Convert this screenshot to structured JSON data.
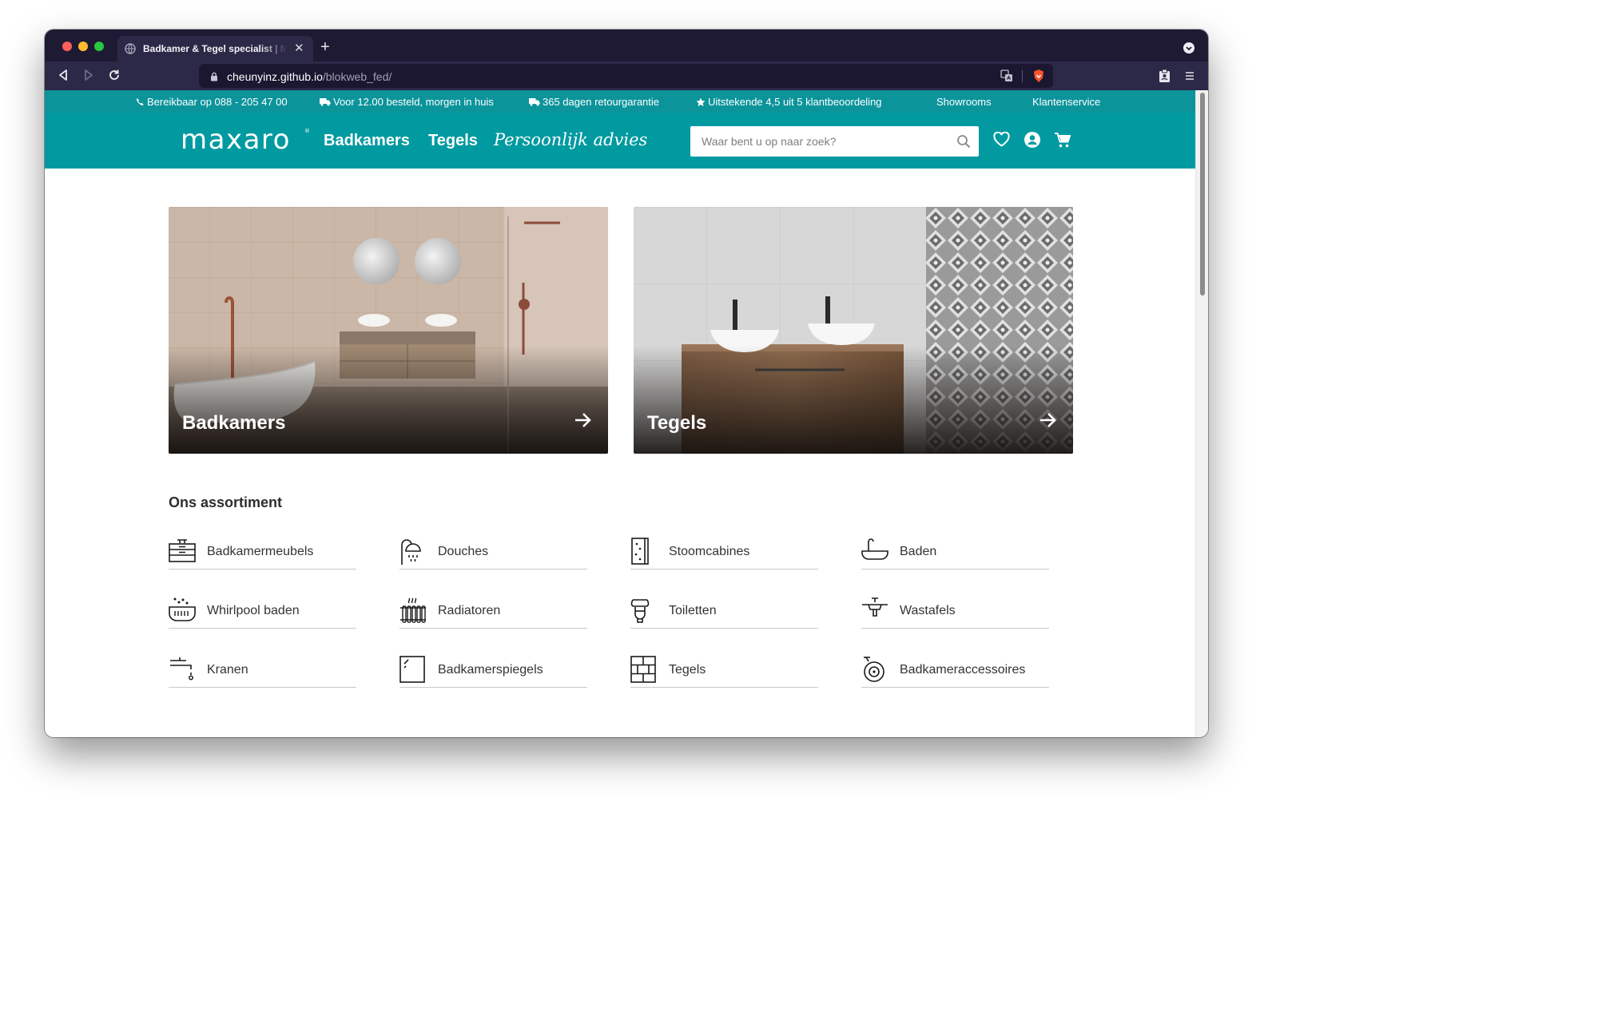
{
  "browser": {
    "tab_title": "Badkamer & Tegel specialist | Maxaro",
    "url_host": "cheunyinz.github.io",
    "url_path": "/blokweb_fed/",
    "colors": {
      "chrome_dark": "#1e1a33",
      "chrome_tab": "#2c2847",
      "close": "#fe5f57",
      "minimize": "#febc2e",
      "zoom": "#28c840"
    }
  },
  "topbar": {
    "items": [
      {
        "icon": "phone-icon",
        "label": "Bereikbaar op 088 - 205 47 00"
      },
      {
        "icon": "truck-icon",
        "label": "Voor 12.00 besteld, morgen in huis"
      },
      {
        "icon": "truck-icon",
        "label": "365 dagen retourgarantie"
      },
      {
        "icon": "star-icon",
        "label": "Uitstekende 4,5 uit 5 klantbeoordeling"
      },
      {
        "label": "Showrooms"
      },
      {
        "label": "Klantenservice"
      }
    ]
  },
  "header": {
    "logo": "maxaro",
    "logo_mark": "®",
    "nav": [
      "Badkamers",
      "Tegels",
      "Persoonlijk advies"
    ],
    "search_placeholder": "Waar bent u op naar zoek?",
    "brand_color": "#009aa0"
  },
  "hero": [
    {
      "label": "Badkamers"
    },
    {
      "label": "Tegels"
    }
  ],
  "assortment": {
    "title": "Ons assortiment",
    "items": [
      {
        "label": "Badkamermeubels",
        "icon": "vanity-cabinet-icon"
      },
      {
        "label": "Douches",
        "icon": "shower-icon"
      },
      {
        "label": "Stoomcabines",
        "icon": "steam-cabin-icon"
      },
      {
        "label": "Baden",
        "icon": "bathtub-icon"
      },
      {
        "label": "Whirlpool baden",
        "icon": "whirlpool-icon"
      },
      {
        "label": "Radiatoren",
        "icon": "radiator-icon"
      },
      {
        "label": "Toiletten",
        "icon": "toilet-icon"
      },
      {
        "label": "Wastafels",
        "icon": "sink-icon"
      },
      {
        "label": "Kranen",
        "icon": "faucet-icon"
      },
      {
        "label": "Badkamerspiegels",
        "icon": "mirror-icon"
      },
      {
        "label": "Tegels",
        "icon": "tiles-icon"
      },
      {
        "label": "Badkameraccessoires",
        "icon": "toilet-roll-icon"
      }
    ]
  }
}
